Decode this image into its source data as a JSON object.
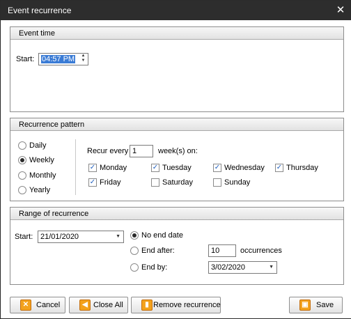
{
  "window": {
    "title": "Event recurrence",
    "close_glyph": "✕"
  },
  "event_time": {
    "header": "Event time",
    "start_label": "Start:",
    "start_value": "04:57 PM"
  },
  "recurrence_pattern": {
    "header": "Recurrence pattern",
    "frequencies": [
      {
        "label": "Daily",
        "selected": false
      },
      {
        "label": "Weekly",
        "selected": true
      },
      {
        "label": "Monthly",
        "selected": false
      },
      {
        "label": "Yearly",
        "selected": false
      }
    ],
    "recur_every_label": "Recur every",
    "recur_every_value": "1",
    "weeks_on_label": "week(s) on:",
    "days": [
      {
        "label": "Monday",
        "checked": true
      },
      {
        "label": "Tuesday",
        "checked": true
      },
      {
        "label": "Wednesday",
        "checked": true
      },
      {
        "label": "Thursday",
        "checked": true
      },
      {
        "label": "Friday",
        "checked": true
      },
      {
        "label": "Saturday",
        "checked": false
      },
      {
        "label": "Sunday",
        "checked": false
      }
    ]
  },
  "range": {
    "header": "Range of recurrence",
    "start_label": "Start:",
    "start_value": "21/01/2020",
    "no_end_label": "No end date",
    "end_after_label": "End after:",
    "end_after_value": "10",
    "occurrences_label": "occurrences",
    "end_by_label": "End by:",
    "end_by_value": "3/02/2020",
    "selected": "no_end"
  },
  "buttons": {
    "cancel": "Cancel",
    "close_all": "Close All",
    "remove": "Remove recurrence",
    "save": "Save"
  },
  "icons": {
    "cancel": "x-icon",
    "close_all": "arrow-left-icon",
    "remove": "trash-icon",
    "save": "save-icon"
  },
  "colors": {
    "titlebar": "#2d2d2d",
    "selection": "#3a7bd5",
    "button_icon": "#f3a21d"
  }
}
